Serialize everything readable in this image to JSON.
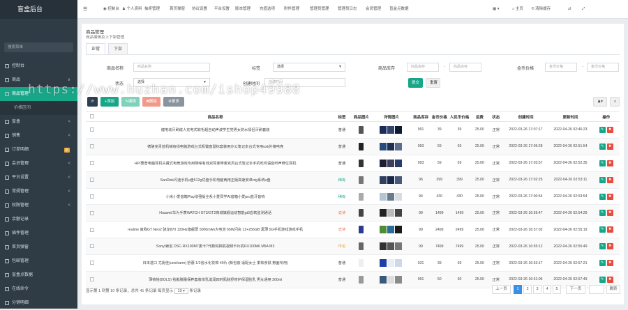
{
  "app": {
    "title": "盲盒后台"
  },
  "sidebar": {
    "search_placeholder": "搜索菜单",
    "items": [
      {
        "label": "控制台",
        "arrow": ""
      },
      {
        "label": "商品",
        "arrow": "∨"
      },
      {
        "label": "商品管理",
        "arrow": "",
        "active": true
      },
      {
        "label": "价格区间",
        "arrow": "",
        "sub": true
      },
      {
        "label": "盲盒",
        "arrow": "<"
      },
      {
        "label": "销售",
        "arrow": "<"
      },
      {
        "label": "订单明细",
        "arrow": "",
        "badge": "新"
      },
      {
        "label": "会员管理",
        "arrow": "<"
      },
      {
        "label": "平台设置",
        "arrow": "<"
      },
      {
        "label": "常规管理",
        "arrow": "<"
      },
      {
        "label": "权限管理",
        "arrow": "<"
      },
      {
        "label": "余额记录",
        "arrow": ""
      },
      {
        "label": "插件管理",
        "arrow": ""
      },
      {
        "label": "首页弹窗",
        "arrow": ""
      },
      {
        "label": "包邮管理",
        "arrow": ""
      },
      {
        "label": "盲盒点数据",
        "arrow": ""
      },
      {
        "label": "在线命令",
        "arrow": ""
      },
      {
        "label": "分销明细",
        "arrow": ""
      }
    ]
  },
  "topbar": {
    "menu": [
      "控制台",
      "个人资料",
      "抽奖管理",
      "首页弹窗",
      "协议设置",
      "平台设置",
      "版本管理",
      "充值选项",
      "附件管理",
      "管理员管理",
      "管理员日志",
      "会员管理",
      "盲盒点数据"
    ],
    "right": [
      "主页",
      "清除缓存"
    ]
  },
  "panel": {
    "title": "商品管理",
    "subtitle": "商品编辑及上下架管理",
    "tabs": [
      "正常",
      "下架"
    ]
  },
  "filters": {
    "name_label": "商品名称",
    "name_placeholder": "商品名称",
    "tag_label": "标签",
    "tag_value": "选择",
    "stock_label": "商品库存",
    "stock_from": "商品库存",
    "stock_to": "商品库存",
    "price_label": "金币价格",
    "price_from": "金币价格",
    "price_to": "金币价格",
    "status_label": "状态",
    "status_value": "选择",
    "created_label": "创建时间",
    "created_placeholder": "创建时间",
    "submit": "提交",
    "reset": "重置"
  },
  "toolbar": {
    "add": "添加",
    "edit": "编辑",
    "delete": "删除",
    "more": "更多"
  },
  "table": {
    "columns": [
      "",
      "商品名称",
      "标签",
      "商品图片",
      "详情图片",
      "商品库存",
      "金币价格",
      "人民币价格",
      "运费",
      "状态",
      "创建时间",
      "更新时间",
      "操作"
    ],
    "rows": [
      {
        "name": "健电动牙刷成人充电式软毛超自动声波学生党男女防水情侣牙刷套装",
        "tag": "普通",
        "stock": "991",
        "coin": "39",
        "rmb": "39",
        "ship": "25.00",
        "status": "正常",
        "created": "2022-03-26 17:07:17",
        "updated": "2022-04-26 02:46:23"
      },
      {
        "name": "德骆克青蓝机械有线电脑游戏台式机键盘鼠标套装用办公笔记本台式专用usb外接电竞",
        "tag": "普通",
        "stock": "993",
        "coin": "69",
        "rmb": "69",
        "ship": "25.00",
        "status": "正常",
        "created": "2022-03-26 17:05:28",
        "updated": "2022-04-26 02:51:54"
      },
      {
        "name": "HP/惠普电脑耳机头戴式电竞游戏专用降噪有线双耳麦带麦克风台式笔记本手机吃鸡语音听声辨位耳机",
        "tag": "普通",
        "stock": "993",
        "coin": "59",
        "rmb": "59",
        "ship": "25.00",
        "status": "正常",
        "created": "2022-03-26 17:03:57",
        "updated": "2022-04-26 02:52:35"
      },
      {
        "name": "SanDisk闪迪手机u盘512g优盘手机电脑两用正版高速安卓otg系统u盘",
        "tag": "稀有",
        "stock": "96",
        "coin": "399",
        "rmb": "399",
        "ship": "25.00",
        "status": "正常",
        "created": "2022-03-26 17:02:25",
        "updated": "2022-04-26 02:53:11"
      },
      {
        "name": "小米小爱音箱Play增强版全系小爱同学AI音箱小爱pro蓝牙音响",
        "tag": "稀有",
        "stock": "94",
        "coin": "430",
        "rmb": "430",
        "ship": "25.00",
        "status": "正常",
        "created": "2022-03-26 17:00:54",
        "updated": "2022-04-26 02:53:54"
      },
      {
        "name": "Huawei/华为手表WATCH GT3/GT2商城旗舰运动智能gt3血氧监测通话",
        "tag": "史诗",
        "stock": "99",
        "coin": "1499",
        "rmb": "1499",
        "ship": "25.00",
        "status": "正常",
        "created": "2022-03-26 16:59:47",
        "updated": "2022-04-26 02:54:29"
      },
      {
        "name": "realme 真我GT Neo2 骁龙870 120Hz旗舰屏 5000mAh大电池 65W闪充 12+256GB 黑薄 5G手机游戏游戏手机",
        "tag": "史诗",
        "stock": "99",
        "coin": "2499",
        "rmb": "2499",
        "ship": "25.00",
        "status": "正常",
        "created": "2022-03-26 16:57:02",
        "updated": "2022-04-26 02:55:19"
      },
      {
        "name": "Sony/索尼 DSC-RX100M7黑卡7代数码相机视频卡片机RX100M6 M5A M3",
        "tag": "传说",
        "stock": "99",
        "coin": "7499",
        "rmb": "7499",
        "ship": "25.00",
        "status": "正常",
        "created": "2022-03-26 16:55:12",
        "updated": "2022-04-26 02:55:49"
      },
      {
        "name": "日本进口 尤妮佳(unicharm) 舒蕾 1/2省水化妆棉 40片 (新包装 适配女士 柔软亲肤 敷面专用)",
        "tag": "普通",
        "stock": "931",
        "coin": "39",
        "rmb": "39",
        "ship": "25.00",
        "status": "正常",
        "created": "2022-03-26 16:53:17",
        "updated": "2022-04-26 02:57:21"
      },
      {
        "name": "薄荷帕(BOLS) 毯鹅脱睡保养套装体乳滋润四时肌肤舒修护保湿脸乳 男女通用 300ml",
        "tag": "普通",
        "stock": "991",
        "coin": "50",
        "rmb": "50",
        "ship": "25.00",
        "status": "正常",
        "created": "2022-03-26 16:51:06",
        "updated": "2022-04-26 02:57:49"
      }
    ]
  },
  "footer": {
    "info": "显示第 1 到第 10 条记录，总共 41 条记录 每页显示",
    "page_size": "10",
    "info_tail": "条记录",
    "prev": "上一页",
    "pages": [
      "1",
      "2",
      "3",
      "4",
      "5"
    ],
    "next": "下一页",
    "jump": "跳转"
  },
  "watermark": "https://www.huzhan.com/ishop49988",
  "colors": {
    "sidebar": "#2f3b45",
    "active": "#18a689",
    "primary": "#3a8ee6",
    "tag_rare": "#18a689",
    "tag_epic": "#e26a4a",
    "tag_legend": "#e8a435"
  }
}
